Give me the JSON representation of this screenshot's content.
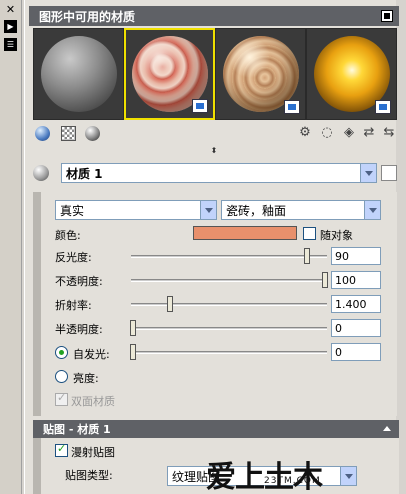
{
  "window": {
    "strip_close": "✕",
    "strip_autohide": "▶",
    "strip_props": "☰"
  },
  "panel": {
    "title": "图形中可用的材质"
  },
  "swatches": [
    {
      "name": "gray-sphere",
      "selected": false,
      "has_badge": false
    },
    {
      "name": "red-marble-sphere",
      "selected": true,
      "has_badge": true
    },
    {
      "name": "tan-stone-sphere",
      "selected": false,
      "has_badge": true
    },
    {
      "name": "glowing-sphere",
      "selected": false,
      "has_badge": true
    }
  ],
  "material": {
    "name": "材质 1"
  },
  "template": {
    "type": "真实",
    "template": "瓷砖，釉面"
  },
  "properties": {
    "color_label": "颜色:",
    "color_value": "#e8906c",
    "by_object_label": "随对象",
    "by_object_checked": false,
    "shininess_label": "反光度:",
    "shininess_value": "90",
    "opacity_label": "不透明度:",
    "opacity_value": "100",
    "refraction_label": "折射率:",
    "refraction_value": "1.400",
    "translucency_label": "半透明度:",
    "translucency_value": "0",
    "self_illum_label": "自发光:",
    "self_illum_value": "0",
    "self_illum_selected": true,
    "luminance_label": "亮度:",
    "luminance_selected": false,
    "two_sided_label": "双面材质",
    "two_sided_checked": true
  },
  "map_section": {
    "title": "贴图 - 材质 1",
    "diffuse_map_label": "漫射贴图",
    "diffuse_map_checked": true,
    "map_type_label": "贴图类型:",
    "map_type_value": "纹理贴图"
  },
  "watermark": {
    "text": "爱上土木",
    "url": "23TM.COM"
  },
  "colors": {
    "header_bg": "#5f6166",
    "selection_border": "#f0e000",
    "accent_green": "#21a121"
  }
}
